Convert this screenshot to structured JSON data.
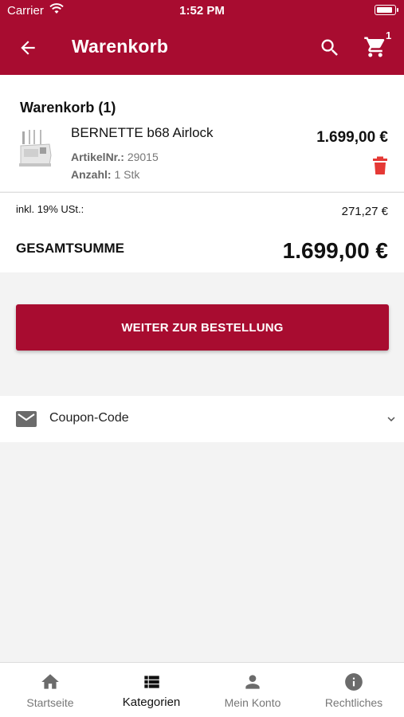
{
  "status_bar": {
    "carrier": "Carrier",
    "time": "1:52 PM"
  },
  "header": {
    "title": "Warenkorb",
    "cart_count": "1"
  },
  "cart": {
    "heading": "Warenkorb (1)",
    "items": [
      {
        "name": "BERNETTE b68 Airlock",
        "price": "1.699,00 €",
        "article_label": "ArtikelNr.:",
        "article_value": "29015",
        "qty_label": "Anzahl:",
        "qty_value": "1 Stk"
      }
    ]
  },
  "totals": {
    "vat_label": "inkl. 19% USt.:",
    "vat_value": "271,27 €",
    "total_label": "GESAMTSUMME",
    "total_value": "1.699,00 €"
  },
  "actions": {
    "order_label": "WEITER ZUR BESTELLUNG"
  },
  "coupon": {
    "label": "Coupon-Code"
  },
  "tabbar": {
    "tabs": [
      {
        "label": "Startseite",
        "icon": "home-icon"
      },
      {
        "label": "Kategorien",
        "icon": "list-icon",
        "active": true
      },
      {
        "label": "Mein Konto",
        "icon": "person-icon"
      },
      {
        "label": "Rechtliches",
        "icon": "info-icon"
      }
    ]
  },
  "colors": {
    "brand": "#a80c30",
    "delete": "#e53935",
    "tab_icon": "#6b6b6b",
    "tab_icon_active": "#111111"
  }
}
